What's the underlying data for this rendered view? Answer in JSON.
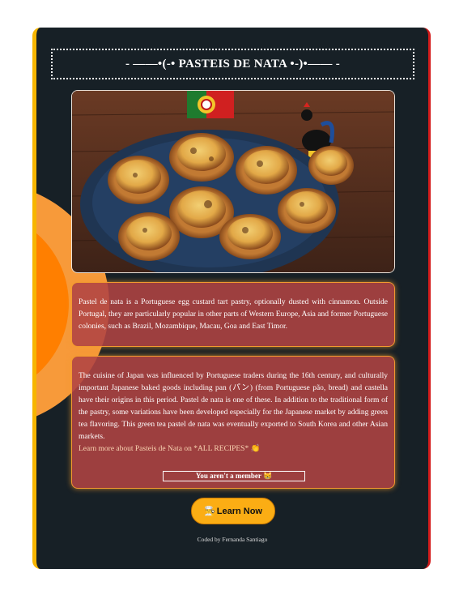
{
  "title": "- ——•(-• PASTEIS DE NATA •-)•—— -",
  "hero": {
    "description": "Plate of Portuguese custard tarts on a wooden table with a Portuguese flag and a Barcelos rooster figurine"
  },
  "intro": "Pastel de nata is a Portuguese egg custard tart pastry, optionally dusted with cinnamon. Outside Portugal, they are particularly popular in other parts of Western Europe, Asia and former Portuguese colonies, such as Brazil, Mozambique, Macau, Goa and East Timor.",
  "japan": "The cuisine of Japan was influenced by Portuguese traders during the 16th century, and culturally important Japanese baked goods including pan (パン) (from Portuguese pão, bread) and castella have their origins in this period. Pastel de nata is one of these. In addition to the traditional form of the pastry, some variations have been developed especially for the Japanese market by adding green tea flavoring. This green tea pastel de nata was eventually exported to South Korea and other Asian markets.",
  "learn_more": "Learn more about Pasteis de Nata on *ALL RECIPES* 👏",
  "member_text": "You aren't a member 😸",
  "button": {
    "label": "Learn Now",
    "icon": "👨‍🍳"
  },
  "footer": "Coded by Fernanda Santiago",
  "colors": {
    "card_bg": "#172026",
    "panel_bg": "#b04343",
    "accent_orange": "#f29a2e",
    "button_bg": "#fbad14",
    "left_border": "#f7b500",
    "right_border": "#d41b1b"
  }
}
